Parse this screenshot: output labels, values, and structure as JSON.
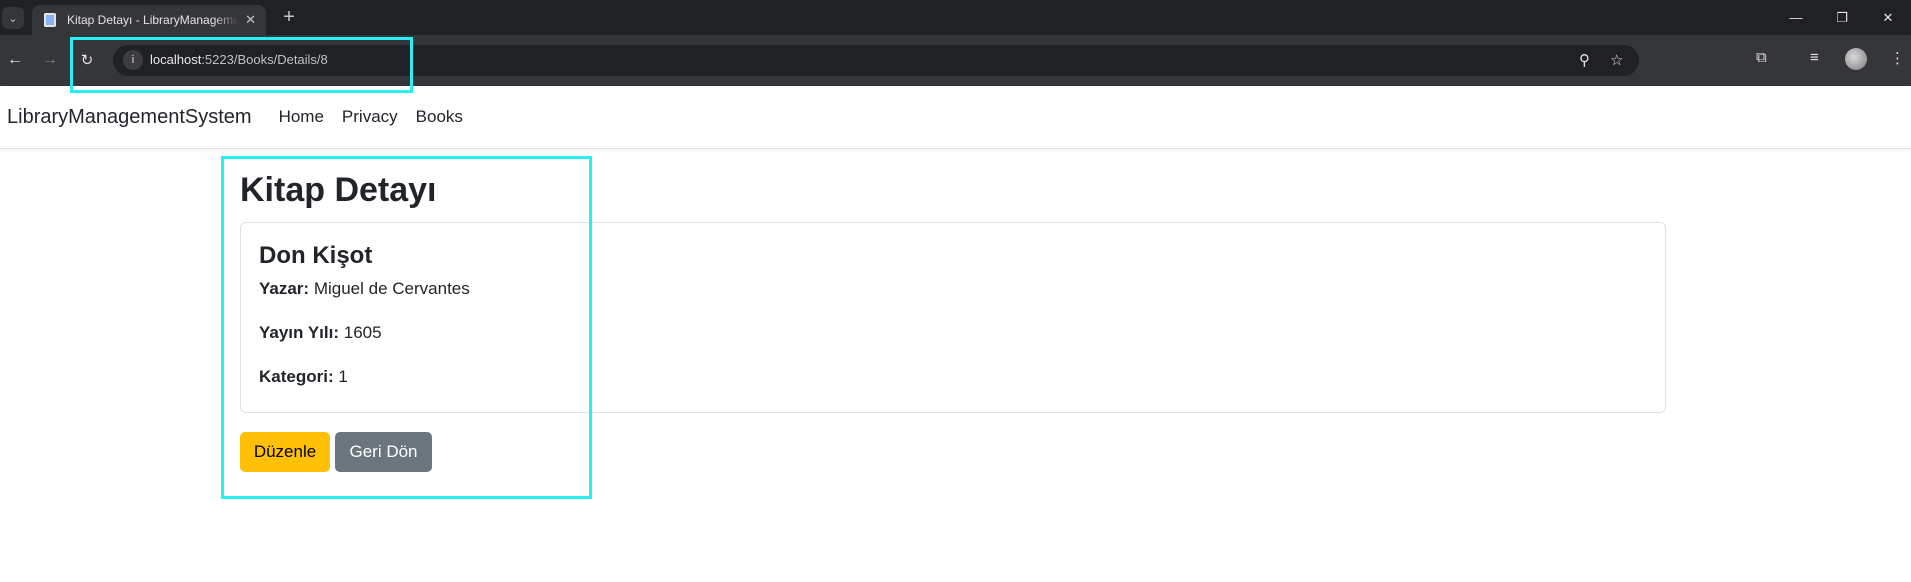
{
  "browser": {
    "tab_title": "Kitap Detayı - LibraryManagementSystem",
    "url_host": "localhost",
    "url_rest": ":5223/Books/Details/8"
  },
  "site": {
    "brand": "LibraryManagementSystem",
    "nav": [
      "Home",
      "Privacy",
      "Books"
    ]
  },
  "page": {
    "title": "Kitap Detayı",
    "book": {
      "name": "Don Kişot",
      "fields": [
        {
          "label": "Yazar:",
          "value": "Miguel de Cervantes"
        },
        {
          "label": "Yayın Yılı:",
          "value": "1605"
        },
        {
          "label": "Kategori:",
          "value": "1"
        }
      ]
    },
    "buttons": {
      "edit": "Düzenle",
      "back": "Geri Dön"
    }
  },
  "colors": {
    "highlight": "#26f0f5",
    "warning": "#ffc107",
    "secondary": "#6c757d"
  }
}
